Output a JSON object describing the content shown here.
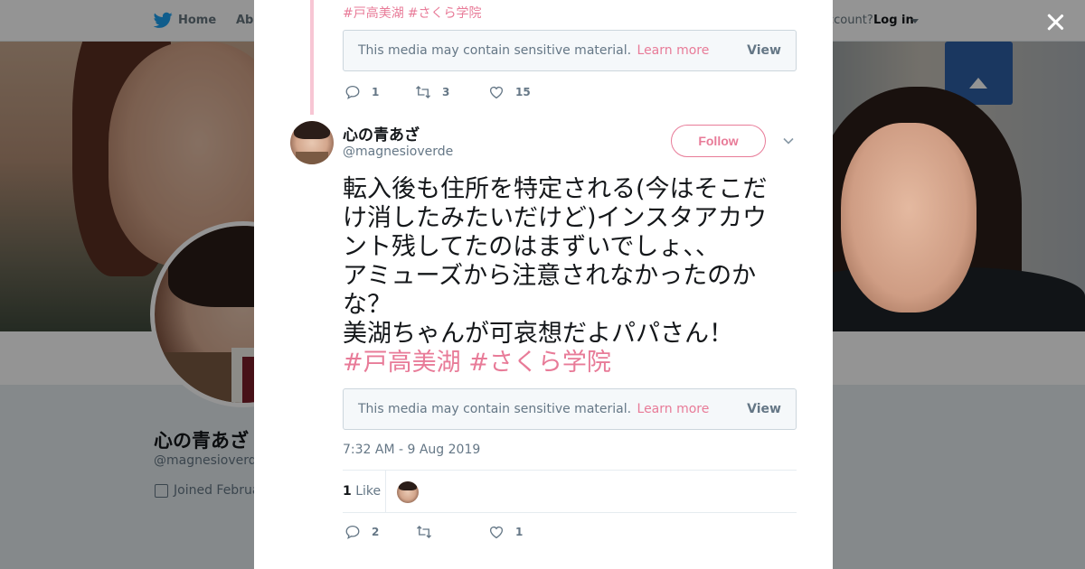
{
  "nav": {
    "home": "Home",
    "about": "Abo",
    "have_account": "ccount?",
    "login": "Log in"
  },
  "profile": {
    "name": "心の青あざ",
    "handle": "@magnesioverde",
    "joined": "Joined Februa"
  },
  "prev_tweet": {
    "hashtags": [
      "#戸高美湖",
      "#さくら学院"
    ],
    "sensitive": {
      "message": "This media may contain sensitive material.",
      "learn_more": "Learn more",
      "view": "View"
    },
    "actions": {
      "replies": "1",
      "retweets": "3",
      "likes": "15"
    }
  },
  "tweet": {
    "author_name": "心の青あざ",
    "author_handle": "@magnesioverde",
    "follow_label": "Follow",
    "text_lines": [
      "転入後も住所を特定される(今はそこだ",
      "け消したみたいだけど)インスタアカウ",
      "ント残してたのはまずいでしょ、、",
      "アミューズから注意されなかったのか",
      "な？",
      "美湖ちゃんが可哀想だよパパさん！"
    ],
    "hashtags": [
      "#戸高美湖",
      "#さくら学院"
    ],
    "sensitive": {
      "message": "This media may contain sensitive material.",
      "learn_more": "Learn more",
      "view": "View"
    },
    "timestamp": "7:32 AM - 9 Aug 2019",
    "like_count": "1",
    "like_label": "Like",
    "actions": {
      "replies": "2",
      "retweets": "",
      "likes": "1"
    }
  },
  "colors": {
    "accent": "#e87b98",
    "thread_line": "#f7c6d4",
    "muted_text": "#657786",
    "overlay": "rgba(0,0,0,0.42)"
  },
  "icons": [
    "twitter-bird-icon",
    "caret-down-icon",
    "close-icon",
    "reply-icon",
    "retweet-icon",
    "heart-icon",
    "calendar-icon",
    "chevron-down-icon"
  ]
}
